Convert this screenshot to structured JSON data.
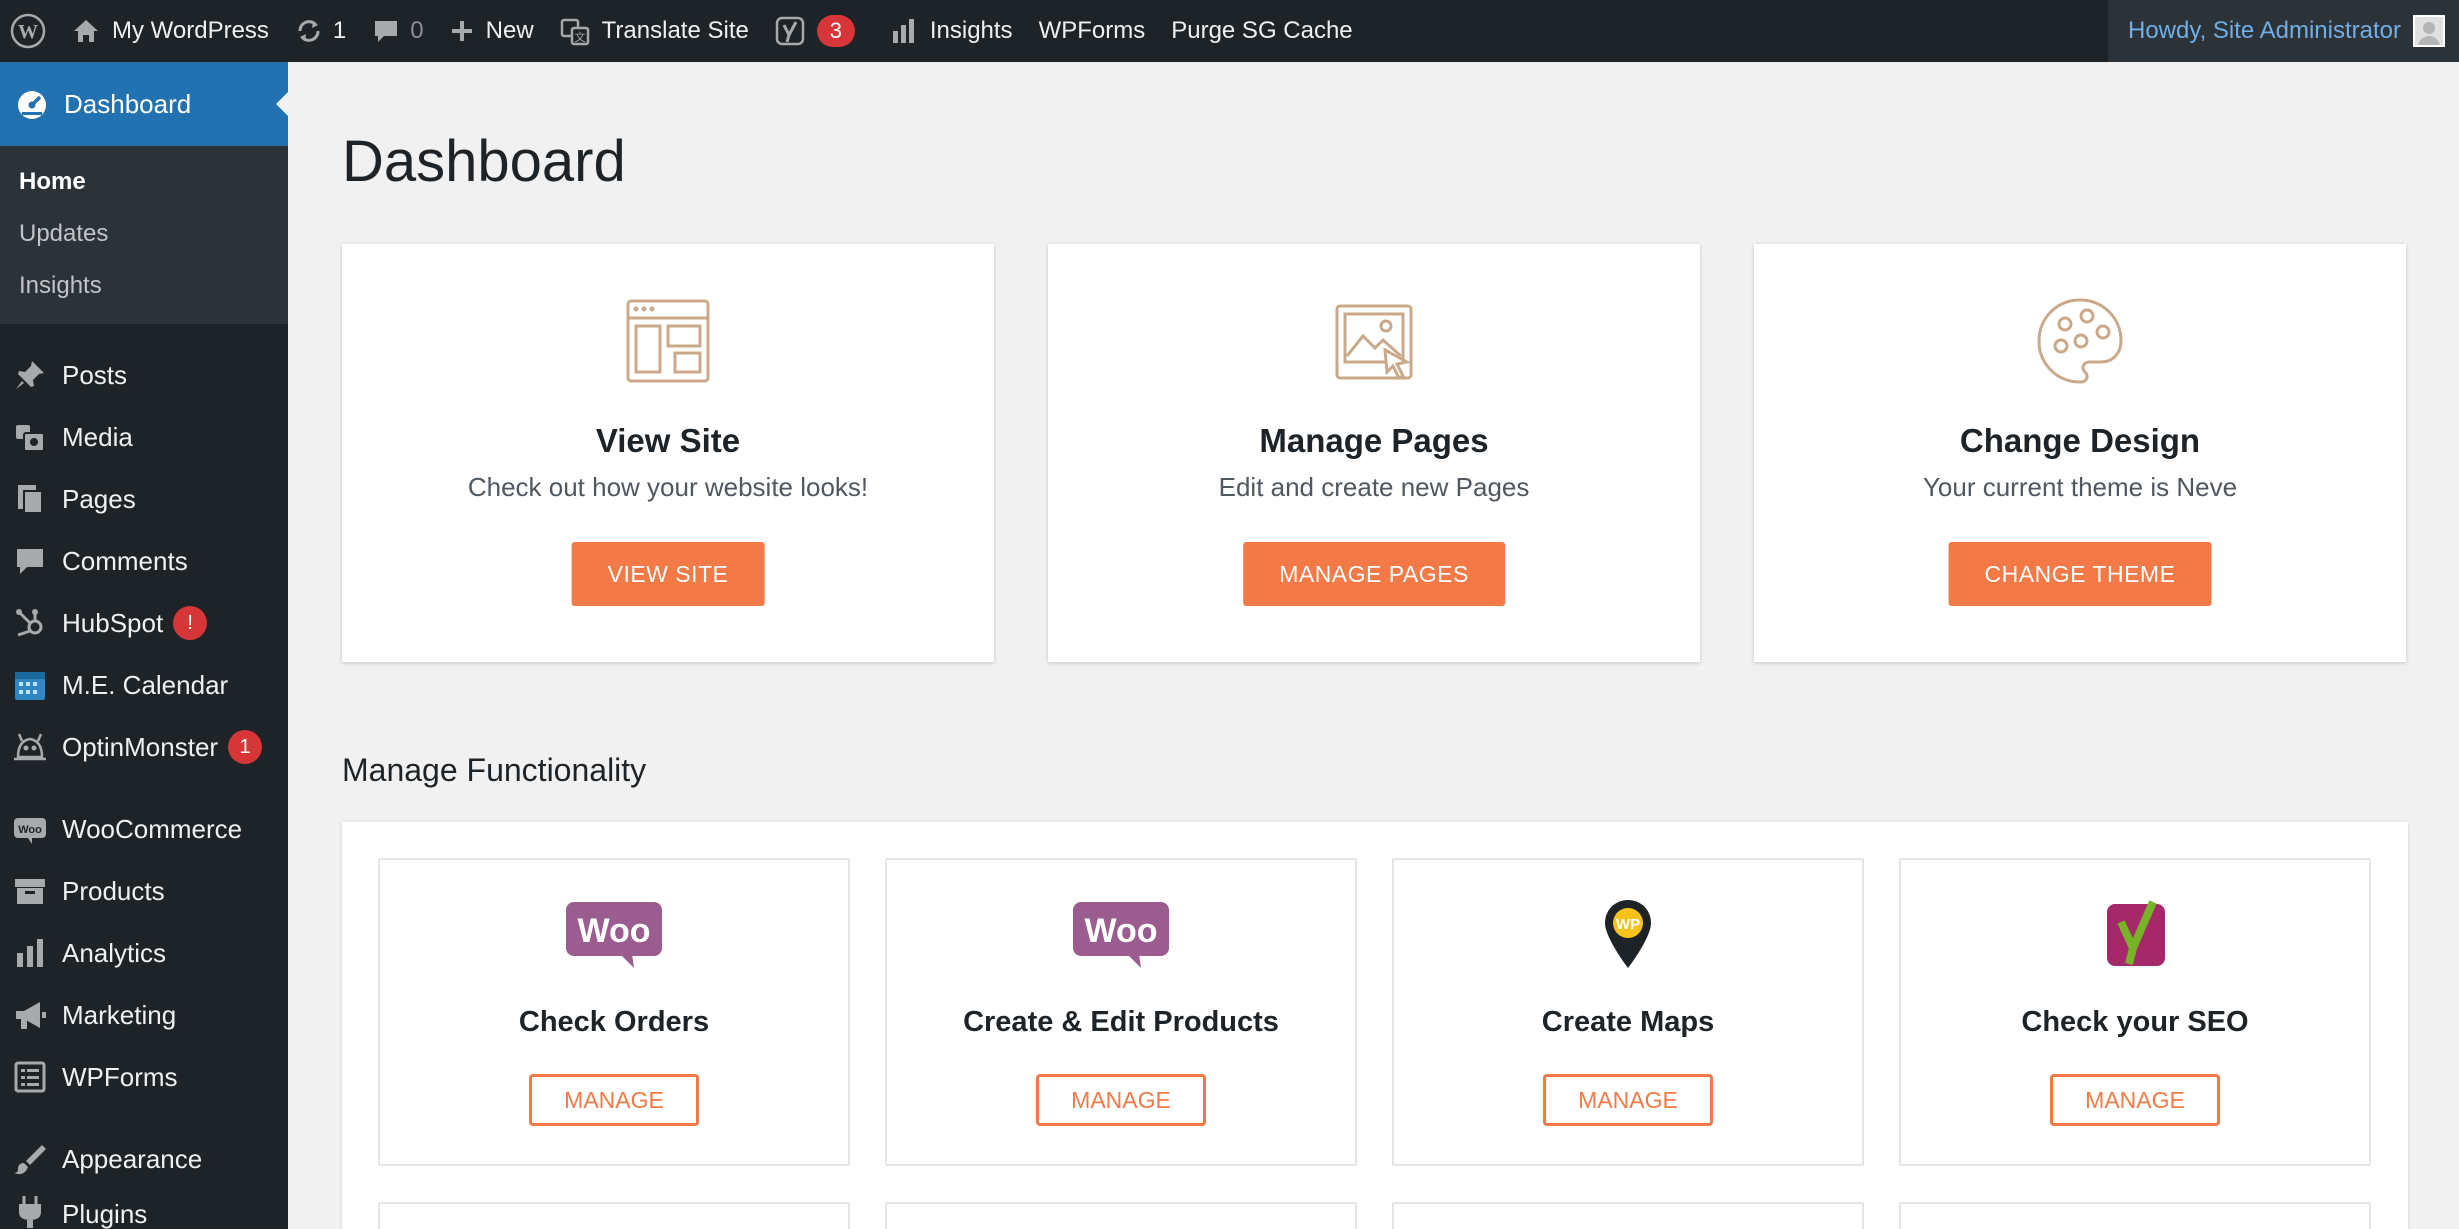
{
  "adminbar": {
    "site_name": "My WordPress",
    "updates_count": "1",
    "comments_count": "0",
    "new_label": "New",
    "translate_label": "Translate Site",
    "yoast_count": "3",
    "insights_label": "Insights",
    "wpforms_label": "WPForms",
    "purge_label": "Purge SG Cache",
    "howdy": "Howdy, Site Administrator"
  },
  "sidebar": {
    "current": "Dashboard",
    "submenu": [
      "Home",
      "Updates",
      "Insights"
    ],
    "items": [
      {
        "label": "Posts",
        "icon": "pin-icon"
      },
      {
        "label": "Media",
        "icon": "media-icon"
      },
      {
        "label": "Pages",
        "icon": "pages-icon"
      },
      {
        "label": "Comments",
        "icon": "comments-icon"
      },
      {
        "label": "HubSpot",
        "icon": "hubspot-icon",
        "badge": "!"
      },
      {
        "label": "M.E. Calendar",
        "icon": "calendar-icon"
      },
      {
        "label": "OptinMonster",
        "icon": "optinmonster-icon",
        "badge": "1"
      },
      {
        "label": "WooCommerce",
        "icon": "woo-icon"
      },
      {
        "label": "Products",
        "icon": "archive-icon"
      },
      {
        "label": "Analytics",
        "icon": "chart-bar-icon"
      },
      {
        "label": "Marketing",
        "icon": "megaphone-icon"
      },
      {
        "label": "WPForms",
        "icon": "forms-icon"
      },
      {
        "label": "Appearance",
        "icon": "brush-icon"
      },
      {
        "label": "Plugins",
        "icon": "plugin-icon"
      }
    ]
  },
  "main": {
    "title": "Dashboard",
    "cards": [
      {
        "title": "View Site",
        "desc": "Check out how your website looks!",
        "button": "VIEW SITE"
      },
      {
        "title": "Manage Pages",
        "desc": "Edit and create new Pages",
        "button": "MANAGE PAGES"
      },
      {
        "title": "Change Design",
        "desc": "Your current theme is Neve",
        "button": "CHANGE THEME"
      }
    ],
    "section_title": "Manage Functionality",
    "functions": [
      {
        "title": "Check Orders",
        "button": "MANAGE",
        "icon_text": "Woo"
      },
      {
        "title": "Create & Edit Products",
        "button": "MANAGE",
        "icon_text": "Woo"
      },
      {
        "title": "Create Maps",
        "button": "MANAGE",
        "icon_text": "WP"
      },
      {
        "title": "Check your SEO",
        "button": "MANAGE",
        "icon_text": "y"
      }
    ]
  },
  "colors": {
    "accent_orange": "#f37a46",
    "wp_blue": "#2271b1",
    "woo_purple": "#9b5c8f",
    "bubble_red": "#d63638"
  }
}
